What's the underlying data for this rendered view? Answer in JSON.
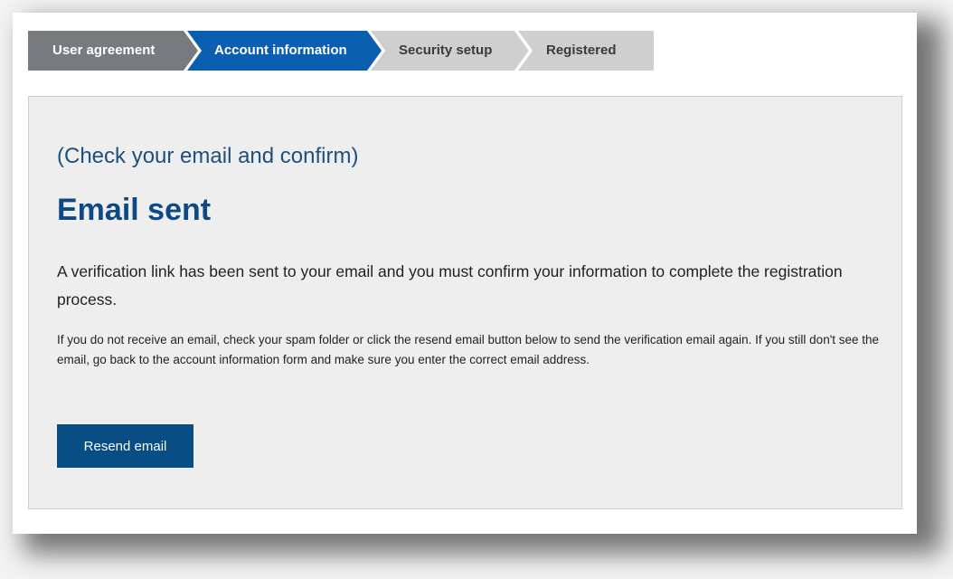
{
  "steps": {
    "user_agreement": "User agreement",
    "account_information": "Account information",
    "security_setup": "Security setup",
    "registered": "Registered",
    "active": "account_information"
  },
  "content": {
    "subheading": "(Check your email and confirm)",
    "title": "Email sent",
    "lead": "A verification link has been sent to your email and you must confirm your information to complete the registration process.",
    "note": "If you do not receive an email, check your spam folder or click the resend email button below to send the verification email again. If you still don't see the email, go back to the account information form and make sure you enter the correct email address.",
    "resend_label": "Resend email"
  },
  "colors": {
    "step_done": "#777b80",
    "step_active": "#0b5fb0",
    "step_pending": "#cfcfcf",
    "title": "#0d4a85",
    "button": "#084d84",
    "panel": "#eeeeee"
  }
}
